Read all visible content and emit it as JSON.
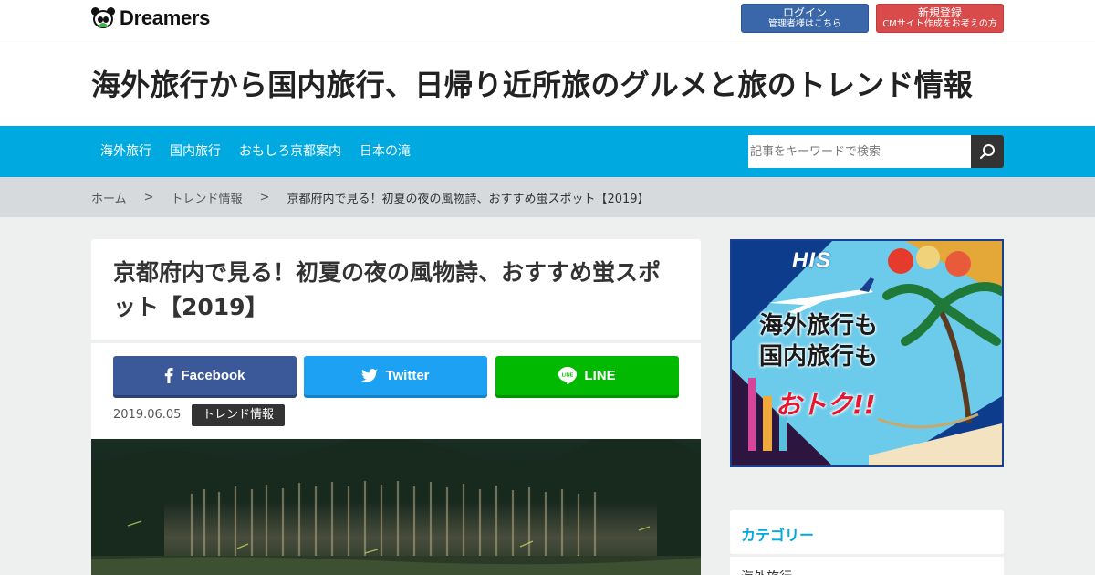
{
  "topbar": {
    "logo_text": "Dreamers",
    "login": {
      "label": "ログイン",
      "sub": "管理者様はこちら"
    },
    "register": {
      "label": "新規登録",
      "sub": "CMサイト作成をお考えの方"
    }
  },
  "header": {
    "site_title": "海外旅行から国内旅行、日帰り近所旅のグルメと旅のトレンド情報"
  },
  "nav": {
    "items": [
      {
        "label": "海外旅行"
      },
      {
        "label": "国内旅行"
      },
      {
        "label": "おもしろ京都案内"
      },
      {
        "label": "日本の滝"
      }
    ],
    "search_placeholder": "記事をキーワードで検索",
    "search_icon": "search-icon"
  },
  "breadcrumb": {
    "home": "ホーム",
    "category": "トレンド情報",
    "current": "京都府内で見る！初夏の夜の風物詩、おすすめ蛍スポット【2019】",
    "separator": ">"
  },
  "article": {
    "title": "京都府内で見る！初夏の夜の風物詩、おすすめ蛍スポット【2019】",
    "share": {
      "facebook": "Facebook",
      "twitter": "Twitter",
      "line": "LINE"
    },
    "date": "2019.06.05",
    "category": "トレンド情報"
  },
  "ad": {
    "brand": "HIS",
    "line1": "海外旅行も",
    "line2": "国内旅行も",
    "line3": "おトク!!"
  },
  "sidebar": {
    "category_heading": "カテゴリー",
    "category_items": [
      {
        "label": "海外旅行"
      }
    ]
  },
  "colors": {
    "nav_bg": "#00a9e0",
    "login_bg": "#3a67a9",
    "register_bg": "#d94a4a",
    "facebook": "#3b5998",
    "twitter": "#1da1f2",
    "line": "#00b900"
  }
}
